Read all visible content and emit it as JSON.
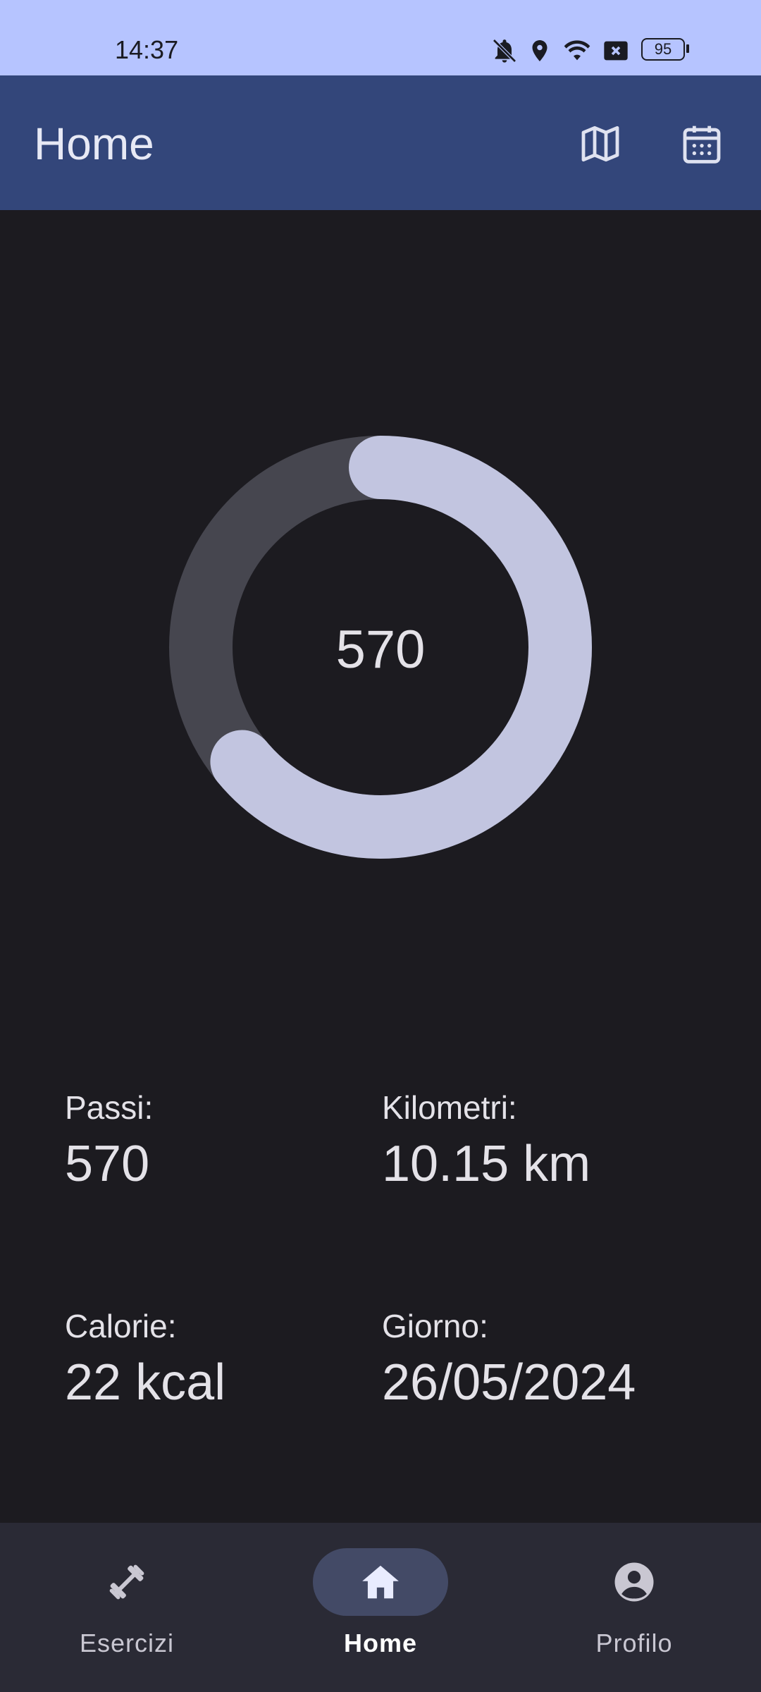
{
  "status_bar": {
    "time": "14:37",
    "icons": [
      "bell-off-icon",
      "location-icon",
      "wifi-icon",
      "x-badge-icon",
      "battery-icon"
    ],
    "battery": "95"
  },
  "app_bar": {
    "title": "Home",
    "actions": [
      "map-icon",
      "calendar-icon"
    ]
  },
  "progress_ring": {
    "value": "570",
    "progress_fraction": 0.64,
    "track_color": "#46464f",
    "progress_color": "#c2c5e0"
  },
  "stats": {
    "steps_label": "Passi:",
    "steps_value": "570",
    "km_label": "Kilometri:",
    "km_value": "10.15 km",
    "calories_label": "Calorie:",
    "calories_value": "22 kcal",
    "day_label": "Giorno:",
    "day_value": "26/05/2024"
  },
  "nav": {
    "items": [
      {
        "label": "Esercizi",
        "icon": "dumbbell-icon",
        "active": false
      },
      {
        "label": "Home",
        "icon": "home-icon",
        "active": true
      },
      {
        "label": "Profilo",
        "icon": "account-circle-icon",
        "active": false
      }
    ]
  }
}
